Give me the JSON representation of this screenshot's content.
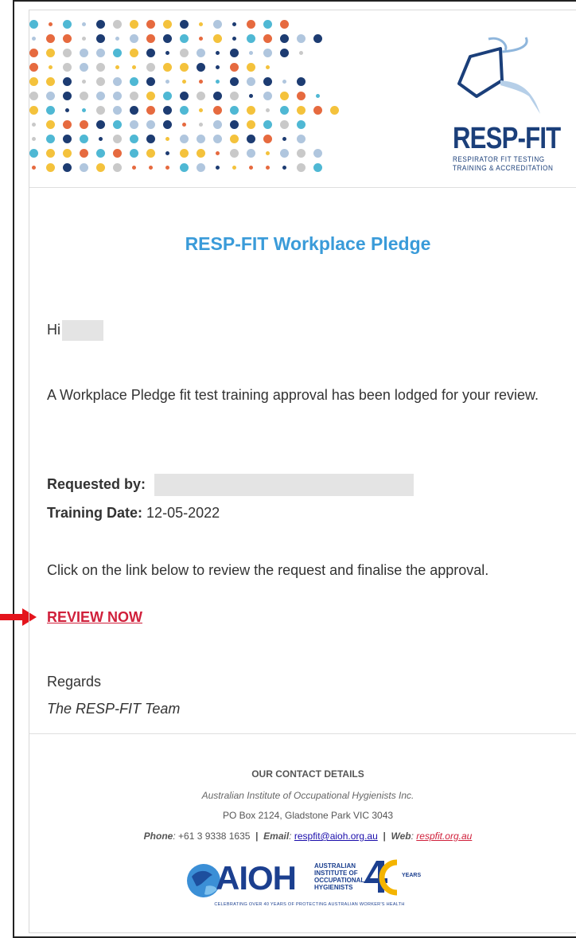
{
  "brand": {
    "logo_title": "RESP-FIT",
    "logo_subtitle_line1": "RESPIRATOR FIT TESTING",
    "logo_subtitle_line2": "TRAINING & ACCREDITATION",
    "dot_colors": [
      "#f4c23c",
      "#e66a3f",
      "#1d3c72",
      "#4fb8d4",
      "#c9c9c9",
      "#b0c6de"
    ]
  },
  "email": {
    "heading": "RESP-FIT Workplace Pledge",
    "greeting": "Hi",
    "intro": "A Workplace Pledge fit test training approval has been lodged for your review.",
    "requested_by_label": "Requested by",
    "training_date_label": "Training Date",
    "training_date_value": "12-05-2022",
    "instruction": "Click on the link below to review the request and finalise the approval.",
    "cta_label": "REVIEW NOW",
    "regards": "Regards",
    "signature": "The RESP-FIT Team"
  },
  "footer": {
    "heading": "OUR CONTACT DETAILS",
    "org": "Australian Institute of Occupational Hygienists Inc.",
    "address": "PO Box 2124, Gladstone Park VIC 3043",
    "phone_label": "Phone",
    "phone_value": "+61 3 9338 1635",
    "email_label": "Email",
    "email_value": "respfit@aioh.org.au",
    "web_label": "Web",
    "web_value": "respfit.org.au",
    "aioh_logo_text": "AIOH",
    "aioh_name": [
      "AUSTRALIAN",
      "INSTITUTE OF",
      "OCCUPATIONAL",
      "HYGIENISTS"
    ],
    "aioh_years": "YEARS",
    "aioh_tagline": "CELEBRATING OVER 40 YEARS OF PROTECTING AUSTRALIAN WORKER'S HEALTH"
  }
}
